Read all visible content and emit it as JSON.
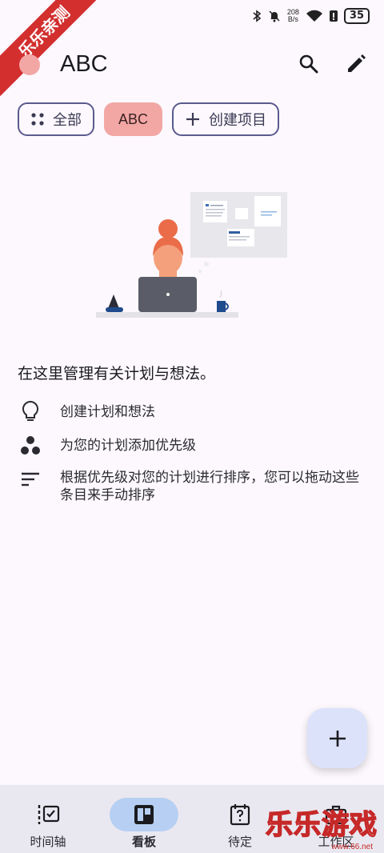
{
  "status_bar": {
    "net_speed_value": "208",
    "net_speed_unit": "B/s",
    "battery": "35",
    "icons": [
      "bluetooth-icon",
      "mute-icon",
      "wifi-icon",
      "alert-icon",
      "battery-icon"
    ]
  },
  "banner": {
    "text": "乐乐亲测"
  },
  "app_bar": {
    "title": "ABC",
    "project_color": "#f2a7a5",
    "actions": [
      "search-icon",
      "edit-icon"
    ]
  },
  "chips": {
    "all": "全部",
    "project": "ABC",
    "create": "创建项目"
  },
  "intro": {
    "title": "在这里管理有关计划与想法。",
    "features": [
      {
        "icon": "lightbulb-icon",
        "text": "创建计划和想法"
      },
      {
        "icon": "priority-dots-icon",
        "text": "为您的计划添加优先级"
      },
      {
        "icon": "sort-icon",
        "text": "根据优先级对您的计划进行排序，您可以拖动这些条目来手动排序"
      }
    ]
  },
  "fab": {
    "icon": "add-icon"
  },
  "bottom_nav": {
    "items": [
      {
        "label": "时间轴",
        "icon": "timeline-icon",
        "active": false
      },
      {
        "label": "看板",
        "icon": "board-icon",
        "active": true
      },
      {
        "label": "待定",
        "icon": "pending-icon",
        "active": false
      },
      {
        "label": "工作区",
        "icon": "briefcase-icon",
        "active": false
      }
    ]
  },
  "watermark": {
    "text": "乐乐游戏",
    "sub": "www.66.net"
  },
  "colors": {
    "accent": "#5b5a8f",
    "project": "#f2a7a5",
    "nav_active": "#b6cff2",
    "fab": "#dde2fb"
  }
}
